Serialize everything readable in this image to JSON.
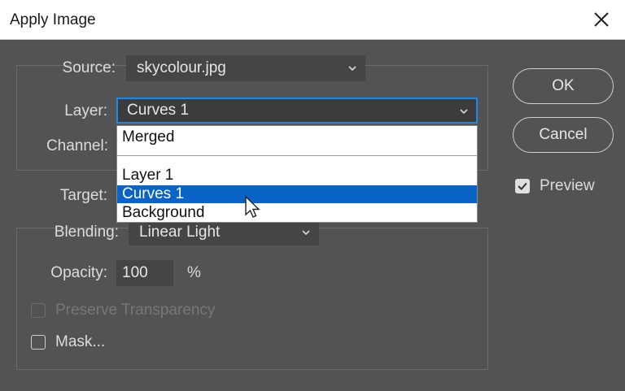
{
  "dialog": {
    "title": "Apply Image"
  },
  "source": {
    "label": "Source:",
    "value": "skycolour.jpg"
  },
  "layer": {
    "label": "Layer:",
    "value": "Curves 1",
    "options": [
      "Merged",
      "Layer 1",
      "Curves 1",
      "Background"
    ],
    "highlighted": "Curves 1"
  },
  "channel": {
    "label": "Channel:"
  },
  "target": {
    "label": "Target:"
  },
  "blending": {
    "label": "Blending:",
    "value": "Linear Light"
  },
  "opacity": {
    "label": "Opacity:",
    "value": "100",
    "unit": "%"
  },
  "preserve_transparency": {
    "label": "Preserve Transparency",
    "checked": false,
    "enabled": false
  },
  "mask": {
    "label": "Mask...",
    "checked": false
  },
  "buttons": {
    "ok": "OK",
    "cancel": "Cancel"
  },
  "preview": {
    "label": "Preview",
    "checked": true
  },
  "colors": {
    "dialog_bg": "#535353",
    "field_bg": "#454545",
    "accent": "#1d88e5",
    "menu_highlight": "#0a64c8"
  },
  "icons": {
    "close": "close-icon",
    "chevron": "chevron-down-icon",
    "check": "checkmark-icon",
    "pointer": "mouse-pointer-icon"
  }
}
